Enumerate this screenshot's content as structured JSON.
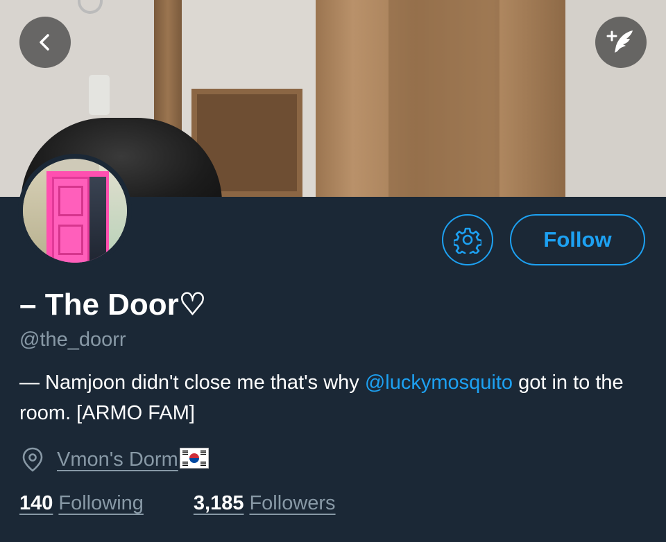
{
  "header": {
    "back_icon": "chevron-left-icon",
    "compose_icon": "compose-tweet-icon"
  },
  "profile": {
    "display_name": "– The Door♡",
    "handle": "@the_doorr",
    "bio_prefix": "— Namjoon didn't close me that's why ",
    "bio_mention": "@luckymosquito",
    "bio_suffix": " got in to the room. [ARMO FAM]",
    "location": "Vmon's Dorm",
    "location_flag": "south-korea-flag"
  },
  "actions": {
    "settings_icon": "gear-icon",
    "follow_label": "Follow"
  },
  "stats": {
    "following_count": "140",
    "following_label": "Following",
    "followers_count": "3,185",
    "followers_label": "Followers"
  },
  "colors": {
    "background": "#1b2836",
    "accent": "#1da1f2",
    "secondary_text": "#8899a6"
  }
}
